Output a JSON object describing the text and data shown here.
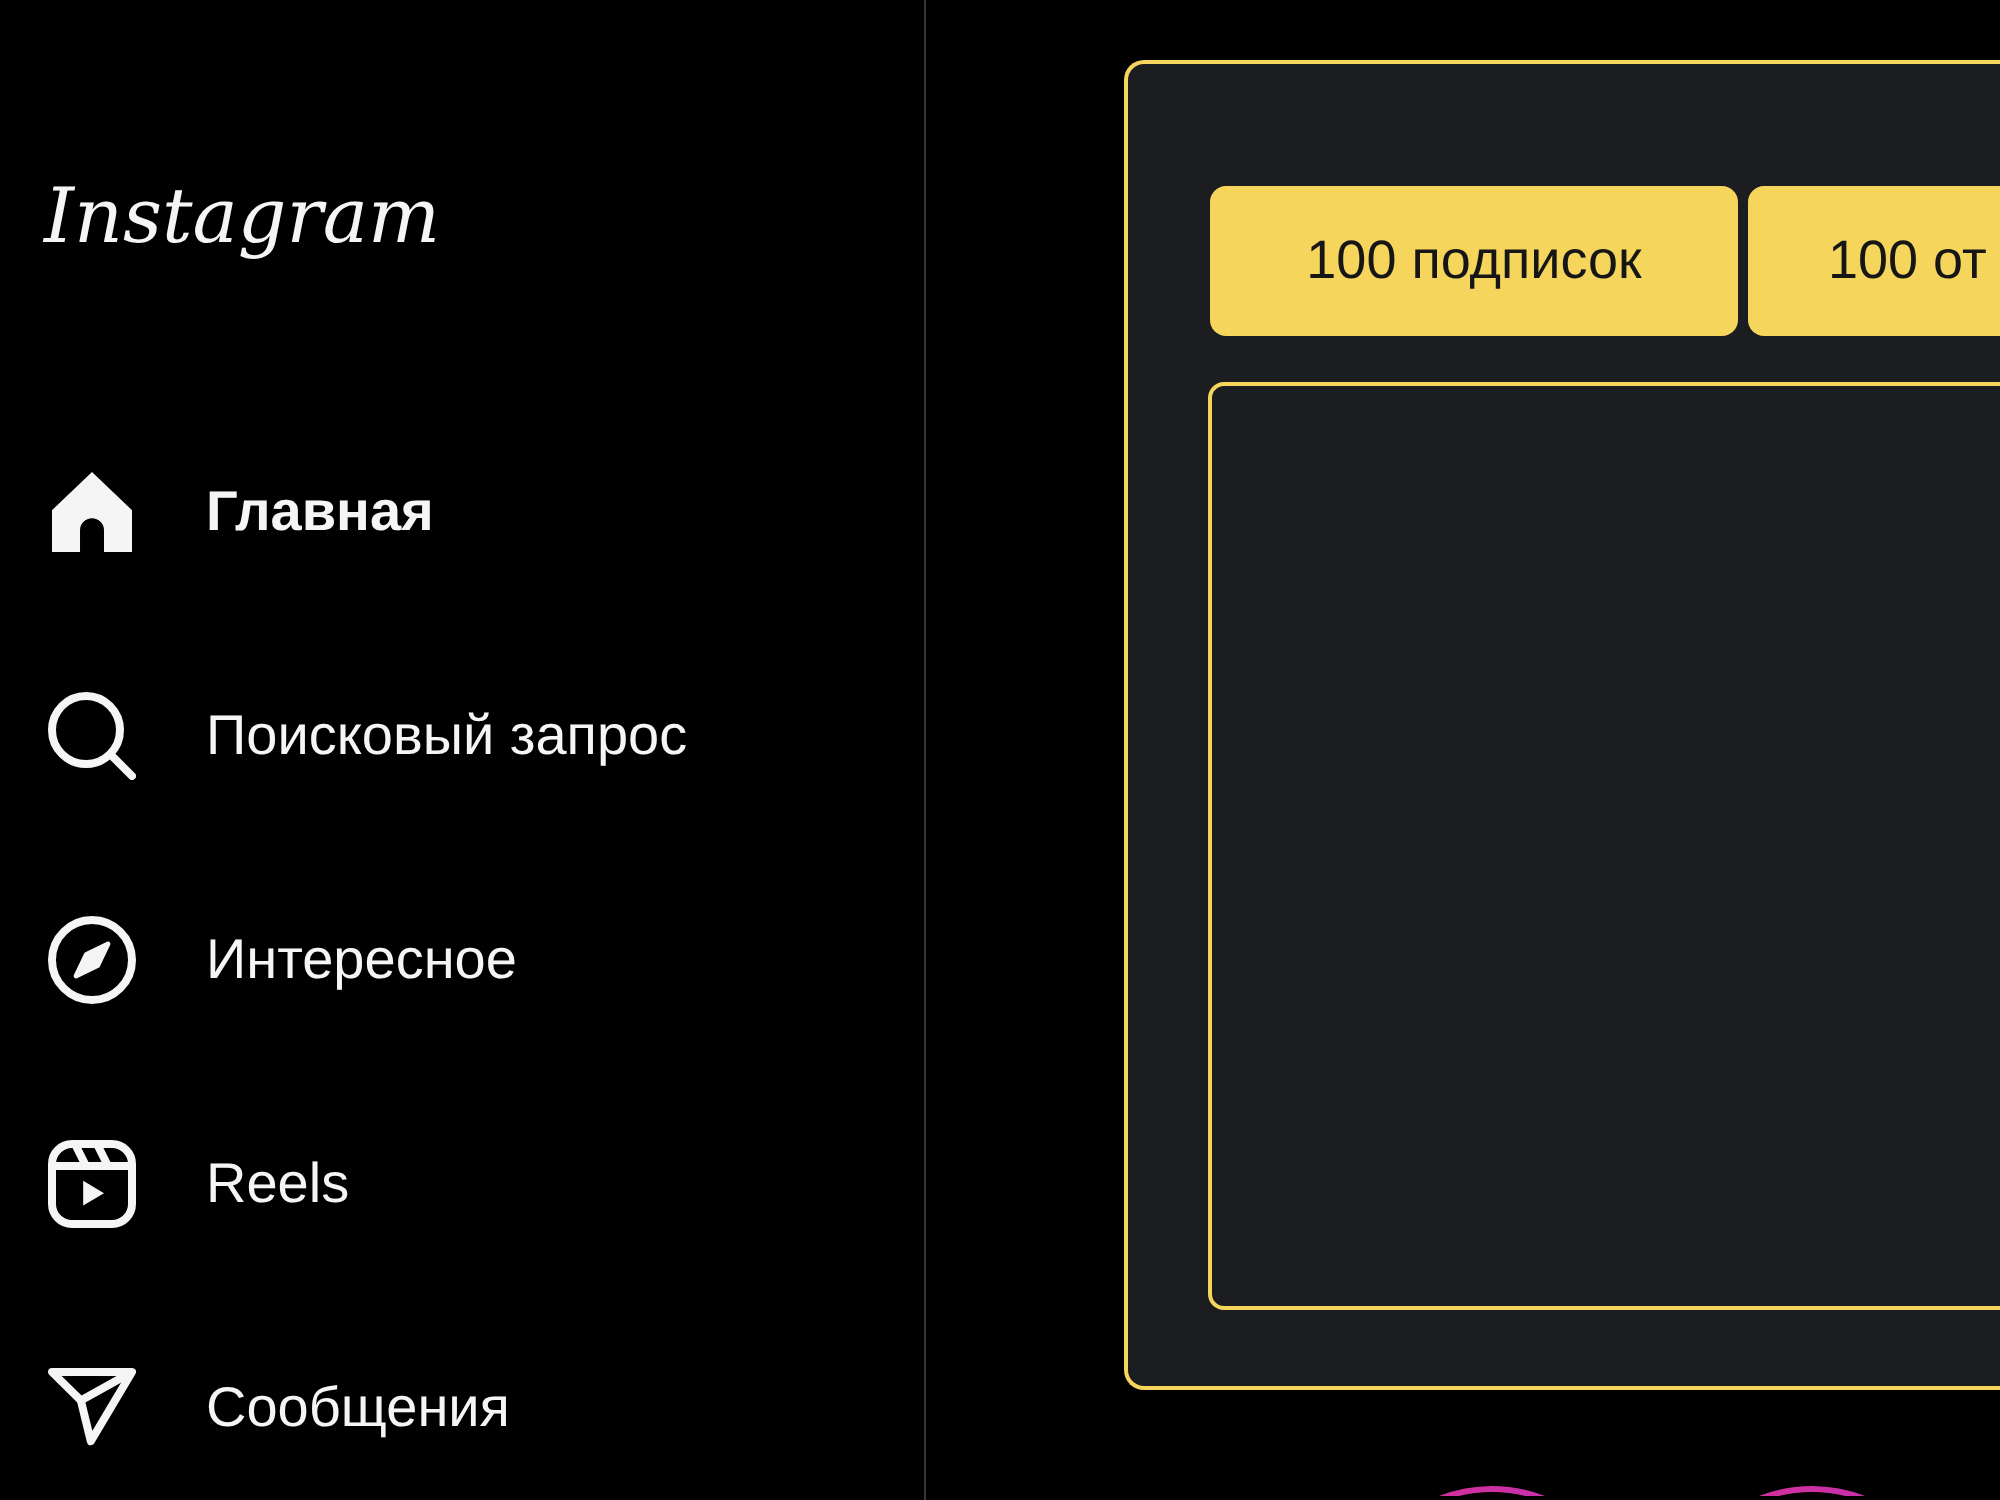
{
  "sidebar": {
    "logo": "Instagram",
    "items": [
      {
        "label": "Главная",
        "selected": true
      },
      {
        "label": "Поисковый запрос",
        "selected": false
      },
      {
        "label": "Интересное",
        "selected": false
      },
      {
        "label": "Reels",
        "selected": false
      },
      {
        "label": "Сообщения",
        "selected": false
      }
    ]
  },
  "panel": {
    "buttons": [
      {
        "label": "100 подписок"
      },
      {
        "label": "100 от"
      }
    ]
  },
  "stories": [
    {
      "seen": false
    },
    {
      "seen": false
    }
  ]
}
